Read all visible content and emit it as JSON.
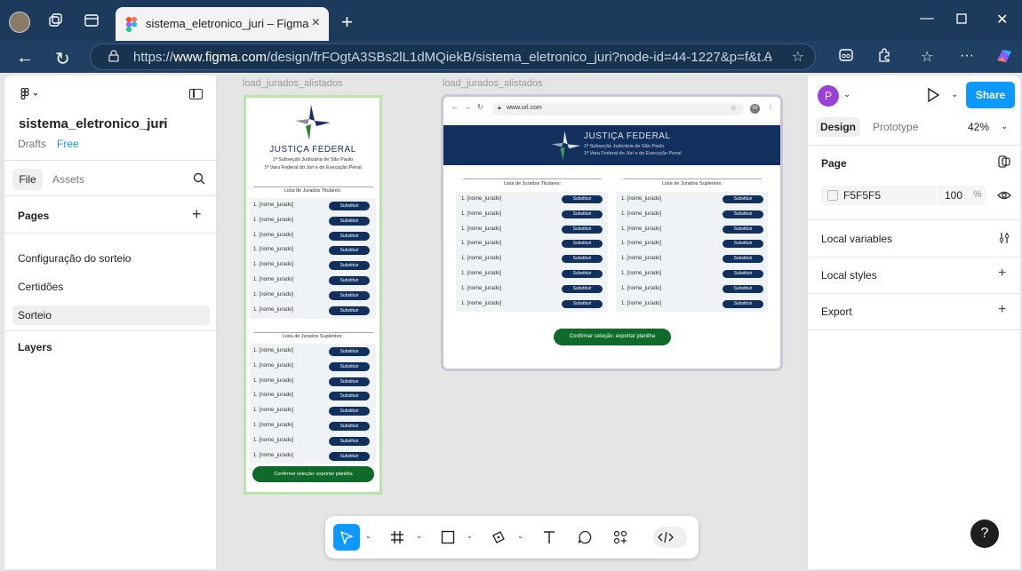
{
  "browser": {
    "tab_title": "sistema_eletronico_juri – Figma",
    "url_prefix": "https://",
    "url_domain": "www.figma.com",
    "url_path": "/design/frFOgtA3SBs2lL1dMQiekB/sistema_eletronico_juri?node-id=44-1227&p=f&t..."
  },
  "left_panel": {
    "file_name": "sistema_eletronico_juri",
    "drafts": "Drafts",
    "plan": "Free",
    "tab_file": "File",
    "tab_assets": "Assets",
    "pages_heading": "Pages",
    "pages": [
      "Configuração do sorteio",
      "Certidões",
      "Sorteio"
    ],
    "layers_heading": "Layers"
  },
  "right_panel": {
    "user_initial": "P",
    "share": "Share",
    "tab_design": "Design",
    "tab_prototype": "Prototype",
    "zoom": "42%",
    "page_heading": "Page",
    "fill_hex": "F5F5F5",
    "fill_opacity": "100",
    "pct": "%",
    "local_variables": "Local variables",
    "local_styles": "Local styles",
    "export": "Export"
  },
  "canvas": {
    "frame1_label": "load_jurados_alistados",
    "frame2_label": "load_jurados_alistados",
    "mock_url": "www.url.com",
    "mock_avatar": "M",
    "org_title": "JUSTIÇA FEDERAL",
    "org_sub1": "1ª Subseção Judiciária de São Paulo",
    "org_sub2": "1ª Vara Federal do Júri e de Execução Penal",
    "titulares_heading": "Lista de Jurados Titulares:",
    "suplentes_heading": "Lista de Jurados Suplentes:",
    "row_name": "1. [nome_jurado]",
    "row_button": "Substituir",
    "confirm_button": "Confirmar seleção: exportar planilha"
  },
  "colors": {
    "accent": "#0d99ff",
    "header_navy": "#12305e",
    "confirm_green": "#0f6b2a"
  }
}
